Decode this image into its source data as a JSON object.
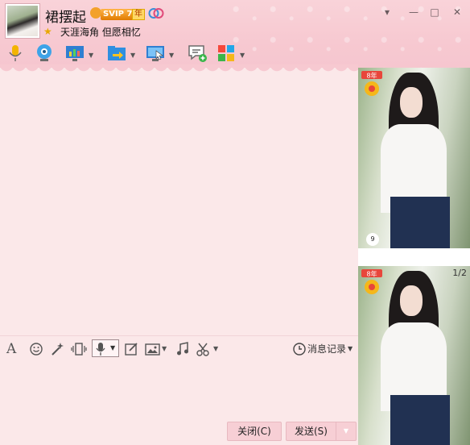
{
  "contact": {
    "nickname": "裙摆起",
    "vip_label": "SVIP 7",
    "year_badge": "年",
    "signature": "天涯海角 但愿相忆"
  },
  "window_controls": [
    "▾",
    "—",
    "□",
    "✕"
  ],
  "toolbar": {
    "icons": [
      "voice-call-icon",
      "video-call-icon",
      "screen-share-icon",
      "file-transfer-icon",
      "remote-desktop-icon",
      "group-chat-icon",
      "apps-icon"
    ]
  },
  "sidebar": {
    "pager": "1/2",
    "year_badge": "8年",
    "badge_count": "9"
  },
  "input_toolbar": {
    "history_label": "消息记录"
  },
  "buttons": {
    "close": "关闭(C)",
    "send": "发送(S)"
  },
  "colors": {
    "header": "#f7c9d1",
    "body": "#fbe8e9",
    "button": "#f7cfd5"
  }
}
